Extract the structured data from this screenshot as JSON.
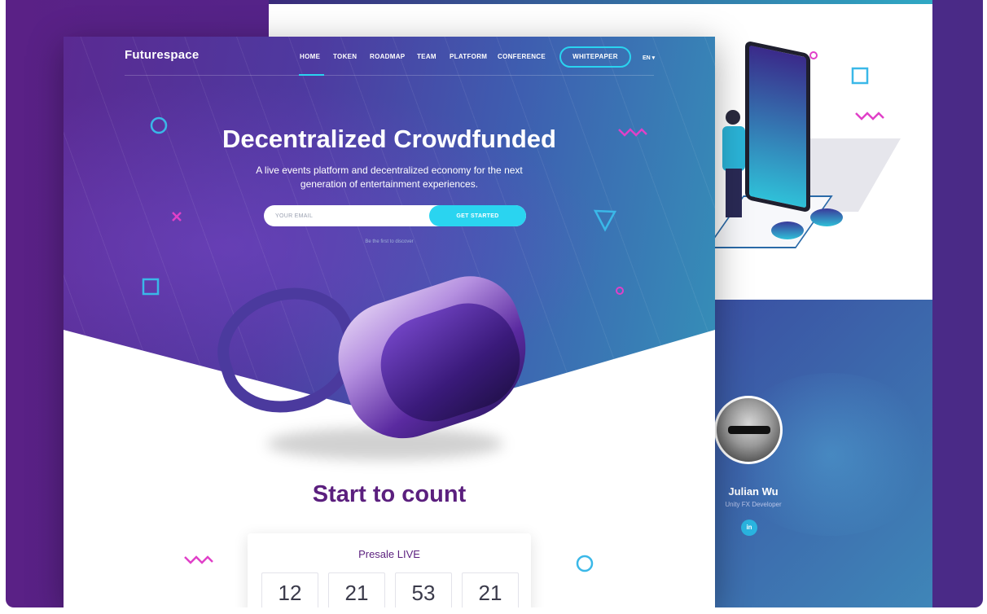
{
  "brand": {
    "name": "Futurespace"
  },
  "nav": {
    "items": [
      {
        "label": "HOME",
        "active": true
      },
      {
        "label": "TOKEN"
      },
      {
        "label": "ROADMAP"
      },
      {
        "label": "TEAM"
      },
      {
        "label": "PLATFORM"
      },
      {
        "label": "CONFERENCE"
      }
    ],
    "whitepaper": "WHITEPAPER",
    "language": "EN ▾"
  },
  "hero": {
    "title": "Decentralized Crowdfunded",
    "subtitle": "A live events platform and decentralized economy for the next generation of entertainment experiences.",
    "email_placeholder": "YOUR EMAIL",
    "cta": "GET STARTED",
    "note": "Be the first to discover"
  },
  "count": {
    "title": "Start to count",
    "presale": "Presale LIVE",
    "values": [
      "12",
      "21",
      "53",
      "21"
    ]
  },
  "team": {
    "name": "Julian Wu",
    "role": "Unity FX Developer",
    "social": "in"
  },
  "colors": {
    "accent": "#2ad4f0",
    "brand_purple": "#5b1f7e",
    "decor_pink": "#e040c8",
    "decor_blue": "#3ab8e8"
  }
}
